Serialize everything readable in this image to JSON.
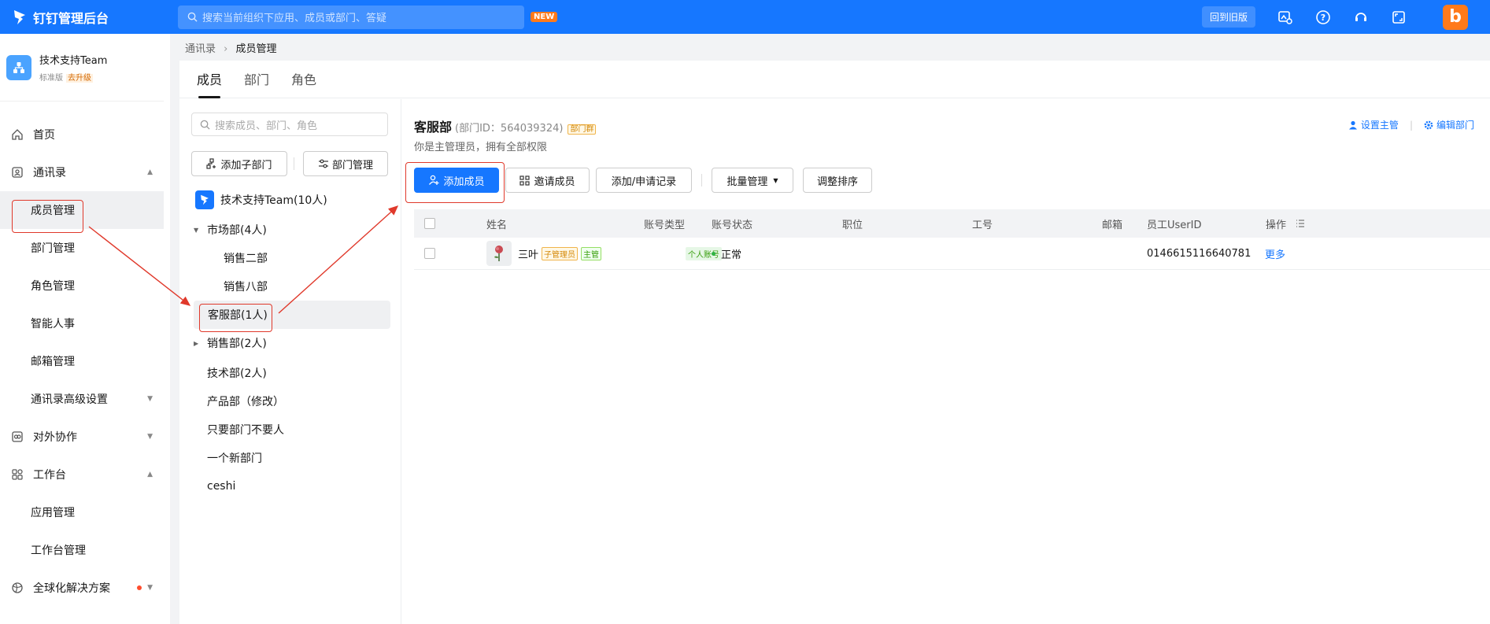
{
  "topbar": {
    "app_title": "钉钉管理后台",
    "search_placeholder": "搜索当前组织下应用、成员或部门、答疑",
    "new_badge": "NEW",
    "old_version_label": "回到旧版",
    "avatar_letter": "b",
    "accent_color": "#1677ff"
  },
  "org": {
    "name": "技术支持Team",
    "edition": "标准版",
    "upgrade_label": "去升级"
  },
  "nav": {
    "home": "首页",
    "contacts": "通讯录",
    "member_mgmt": "成员管理",
    "dept_mgmt": "部门管理",
    "role_mgmt": "角色管理",
    "smart_hr": "智能人事",
    "mail_mgmt": "邮箱管理",
    "contacts_advanced": "通讯录高级设置",
    "external": "对外协作",
    "workbench": "工作台",
    "app_mgmt": "应用管理",
    "workbench_mgmt": "工作台管理",
    "global_solution": "全球化解决方案"
  },
  "breadcrumb": {
    "parent": "通讯录",
    "current": "成员管理"
  },
  "tabs": [
    "成员",
    "部门",
    "角色"
  ],
  "tree": {
    "search_placeholder": "搜索成员、部门、角色",
    "add_sub_dept": "添加子部门",
    "dept_mgmt": "部门管理",
    "root": "技术支持Team(10人)",
    "nodes": {
      "market": "市场部(4人)",
      "sales2": "销售二部",
      "sales8": "销售八部",
      "service": "客服部(1人)",
      "sales": "销售部(2人)",
      "tech": "技术部(2人)",
      "product": "产品部（修改）",
      "only_dept": "只要部门不要人",
      "new_dept": "一个新部门",
      "ceshi": "ceshi"
    }
  },
  "content": {
    "dept_name": "客服部",
    "dept_id": "(部门ID：564039324)",
    "dept_tag": "部门群",
    "desc": "你是主管理员，拥有全部权限",
    "set_manager": "设置主管",
    "edit_dept": "编辑部门",
    "add_member": "添加成员",
    "invite_member": "邀请成员",
    "add_apply_record": "添加/申请记录",
    "batch_mgmt": "批量管理",
    "adjust_order": "调整排序"
  },
  "table": {
    "columns": {
      "name": "姓名",
      "account_type": "账号类型",
      "account_status": "账号状态",
      "position": "职位",
      "job_no": "工号",
      "email": "邮箱",
      "user_id": "员工UserID",
      "operation": "操作"
    },
    "rows": [
      {
        "name": "三叶",
        "tag_admin": "子管理员",
        "tag_manager": "主管",
        "account_type": "个人账号",
        "status": "正常",
        "user_id": "0146615116640781",
        "more": "更多"
      }
    ]
  }
}
